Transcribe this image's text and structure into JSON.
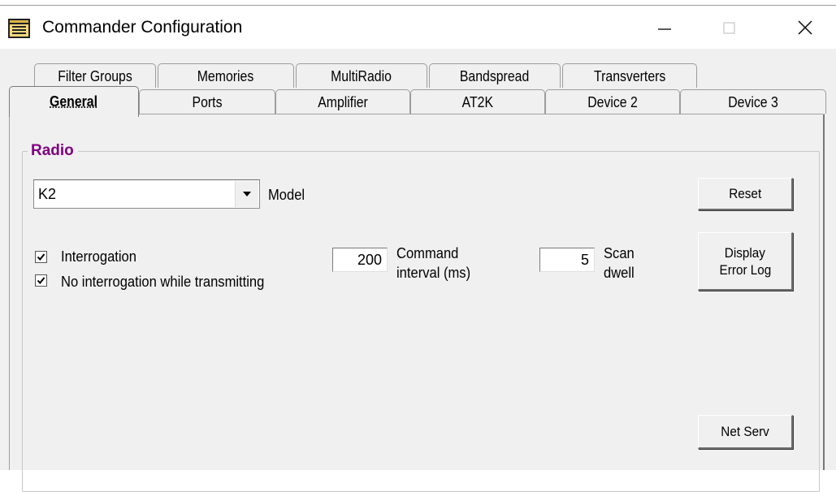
{
  "window": {
    "title": "Commander Configuration",
    "app_icon": "notepad-icon",
    "controls": [
      "minimize-icon",
      "maximize-icon",
      "close-icon"
    ]
  },
  "tabs": {
    "row1": [
      "Filter Groups",
      "Memories",
      "MultiRadio",
      "Bandspread",
      "Transverters"
    ],
    "row2": [
      "General",
      "Ports",
      "Amplifier",
      "AT2K",
      "Device 2",
      "Device 3"
    ],
    "active": "General"
  },
  "radio_group": {
    "title": "Radio",
    "model": {
      "value": "K2",
      "label": "Model"
    },
    "interrogation": {
      "label": "Interrogation",
      "checked": true
    },
    "no_interrogation_tx": {
      "label": "No interrogation while transmitting",
      "checked": true
    },
    "command_interval": {
      "value": "200",
      "label_line1": "Command",
      "label_line2": "interval (ms)"
    },
    "scan_dwell": {
      "value": "5",
      "label_line1": "Scan",
      "label_line2": "dwell"
    },
    "buttons": {
      "reset": "Reset",
      "display_error_log_line1": "Display",
      "display_error_log_line2": "Error Log",
      "net_serv": "Net Serv"
    }
  },
  "colors": {
    "group_title": "#800080",
    "face": "#f0f0f0"
  }
}
